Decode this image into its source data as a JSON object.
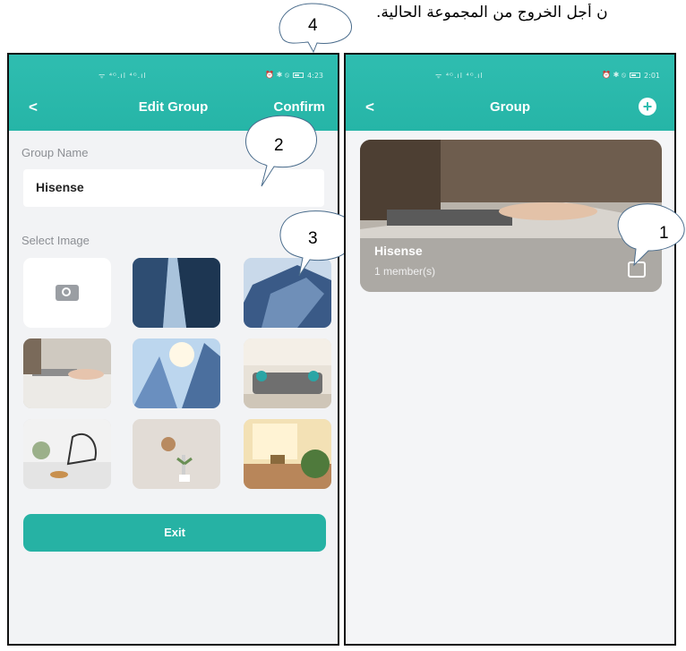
{
  "caption": "ن أجل الخروج من المجموعة الحالية.",
  "callouts": [
    "4",
    "2",
    "3",
    "1"
  ],
  "colors": {
    "accent": "#2fbdb0",
    "button": "#26b2a4"
  },
  "edit_screen": {
    "status_time": "4:23",
    "status_signal": "ᯤ ⁴ᴳ.ıl ⁴ᴳ.ıl",
    "status_icons": "⏰ ✱ ⦸",
    "back_icon": "chevron-left-icon",
    "title": "Edit Group",
    "confirm_label": "Confirm",
    "group_name_label": "Group Name",
    "group_name_value": "Hisense",
    "select_image_label": "Select Image",
    "images": [
      "camera-icon",
      "glass-tower",
      "glass-tower-angle",
      "office-laptop",
      "sky-skyscraper",
      "living-room-sofa",
      "table-decor-flowers",
      "wall-clock-plant",
      "kitchen-window"
    ],
    "exit_label": "Exit"
  },
  "group_screen": {
    "status_time": "2:01",
    "status_signal": "ᯤ ⁴ᴳ.ıl ⁴ᴳ.ıl",
    "status_icons": "⏰ ✱ ⦸",
    "back_icon": "chevron-left-icon",
    "title": "Group",
    "add_icon": "plus-circle-icon",
    "card": {
      "name": "Hisense",
      "members": "1 member(s)",
      "edit_icon": "edit-square-icon"
    }
  }
}
